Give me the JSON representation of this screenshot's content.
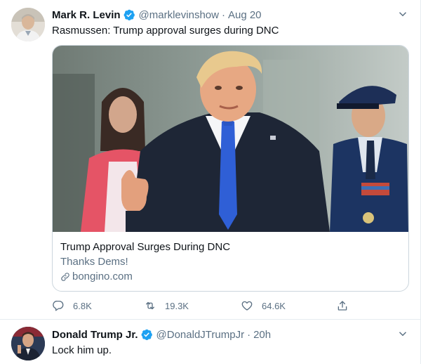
{
  "tweets": [
    {
      "author": {
        "name": "Mark R. Levin",
        "handle": "@marklevinshow",
        "time": "Aug 20",
        "avatar_icon": "avatar-photo"
      },
      "text": "Rasmussen: Trump approval surges during DNC",
      "card": {
        "title": "Trump Approval Surges During DNC",
        "description": "Thanks Dems!",
        "domain": "bongino.com",
        "image_icon": "news-photo"
      },
      "actions": {
        "reply_count": "6.8K",
        "retweet_count": "19.3K",
        "like_count": "64.6K"
      }
    },
    {
      "author": {
        "name": "Donald Trump Jr.",
        "handle": "@DonaldJTrumpJr",
        "time": "20h",
        "avatar_icon": "avatar-photo"
      },
      "text": "Lock him up."
    }
  ],
  "colors": {
    "text_primary": "#0f1419",
    "text_secondary": "#5b7083",
    "verified_badge": "#1da1f2",
    "border": "#ccd6dd"
  }
}
